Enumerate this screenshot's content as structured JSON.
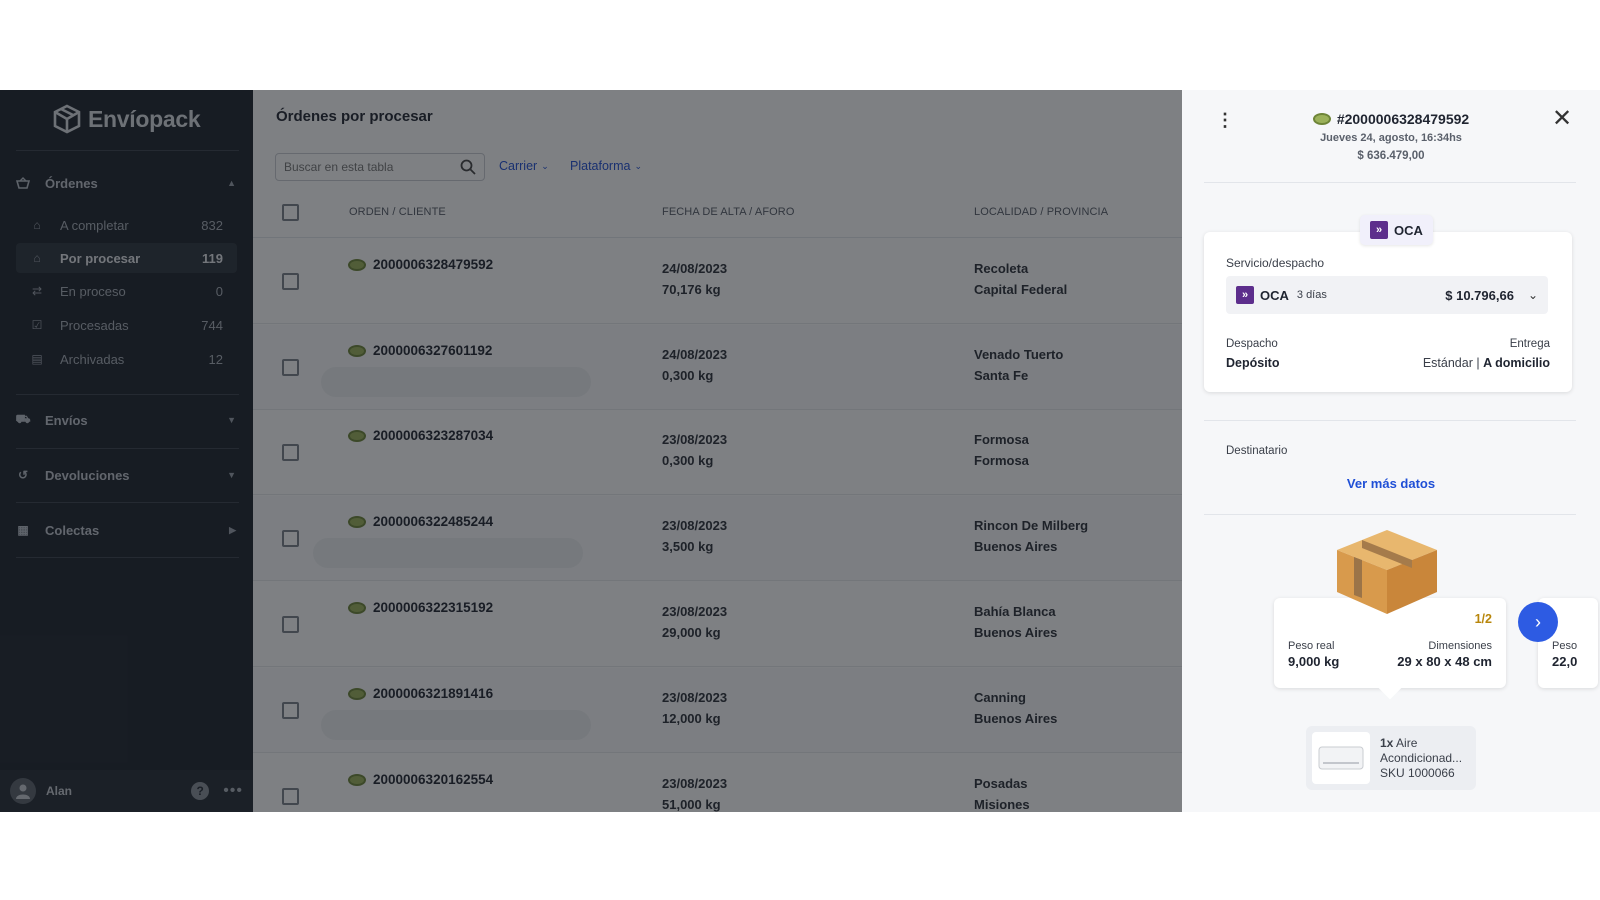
{
  "brand": {
    "name": "Envíopack"
  },
  "sidebar": {
    "sections": {
      "ordenes": {
        "label": "Órdenes"
      },
      "envios": {
        "label": "Envíos"
      },
      "devoluciones": {
        "label": "Devoluciones"
      },
      "colectas": {
        "label": "Colectas"
      }
    },
    "items": [
      {
        "label": "A completar",
        "count": "832"
      },
      {
        "label": "Por procesar",
        "count": "119"
      },
      {
        "label": "En proceso",
        "count": "0"
      },
      {
        "label": "Procesadas",
        "count": "744"
      },
      {
        "label": "Archivadas",
        "count": "12"
      }
    ],
    "user": {
      "name": "Alan"
    }
  },
  "main": {
    "title": "Órdenes por procesar",
    "search_placeholder": "Buscar en esta tabla",
    "filters": {
      "carrier": "Carrier",
      "plataforma": "Plataforma"
    },
    "columns": {
      "orden": "ORDEN / CLIENTE",
      "fecha": "FECHA DE ALTA / AFORO",
      "localidad": "LOCALIDAD / PROVINCIA"
    },
    "rows": [
      {
        "order": "2000006328479592",
        "date": "24/08/2023",
        "weight": "70,176 kg",
        "city": "Recoleta",
        "province": "Capital Federal"
      },
      {
        "order": "2000006327601192",
        "date": "24/08/2023",
        "weight": "0,300 kg",
        "city": "Venado Tuerto",
        "province": "Santa Fe"
      },
      {
        "order": "2000006323287034",
        "date": "23/08/2023",
        "weight": "0,300 kg",
        "city": "Formosa",
        "province": "Formosa"
      },
      {
        "order": "2000006322485244",
        "date": "23/08/2023",
        "weight": "3,500 kg",
        "city": "Rincon De Milberg",
        "province": "Buenos Aires"
      },
      {
        "order": "2000006322315192",
        "date": "23/08/2023",
        "weight": "29,000 kg",
        "city": "Bahía Blanca",
        "province": "Buenos Aires"
      },
      {
        "order": "2000006321891416",
        "date": "23/08/2023",
        "weight": "12,000 kg",
        "city": "Canning",
        "province": "Buenos Aires"
      },
      {
        "order": "2000006320162554",
        "date": "23/08/2023",
        "weight": "51,000 kg",
        "city": "Posadas",
        "province": "Misiones"
      }
    ]
  },
  "panel": {
    "order_title": "#2000006328479592",
    "date": "Jueves 24, agosto, 16:34hs",
    "amount": "$ 636.479,00",
    "carrier_chip": "OCA",
    "service_label": "Servicio/despacho",
    "service": {
      "carrier": "OCA",
      "days": "3 días",
      "price": "$ 10.796,66"
    },
    "despacho_label": "Despacho",
    "despacho_value": "Depósito",
    "entrega_label": "Entrega",
    "entrega_value_1": "Estándar |",
    "entrega_value_2": "A domicilio",
    "destinatario_label": "Destinatario",
    "ver_mas": "Ver más datos",
    "package": {
      "pager": "1/2",
      "peso_label": "Peso real",
      "peso_value": "9,000 kg",
      "dim_label": "Dimensiones",
      "dim_value": "29 x 80 x 48 cm",
      "peso2_label": "Peso",
      "peso2_value": "22,0"
    },
    "item": {
      "qty": "1x",
      "name_1": "Aire",
      "name_2": "Acondicionad...",
      "sku": "SKU 1000066"
    }
  }
}
